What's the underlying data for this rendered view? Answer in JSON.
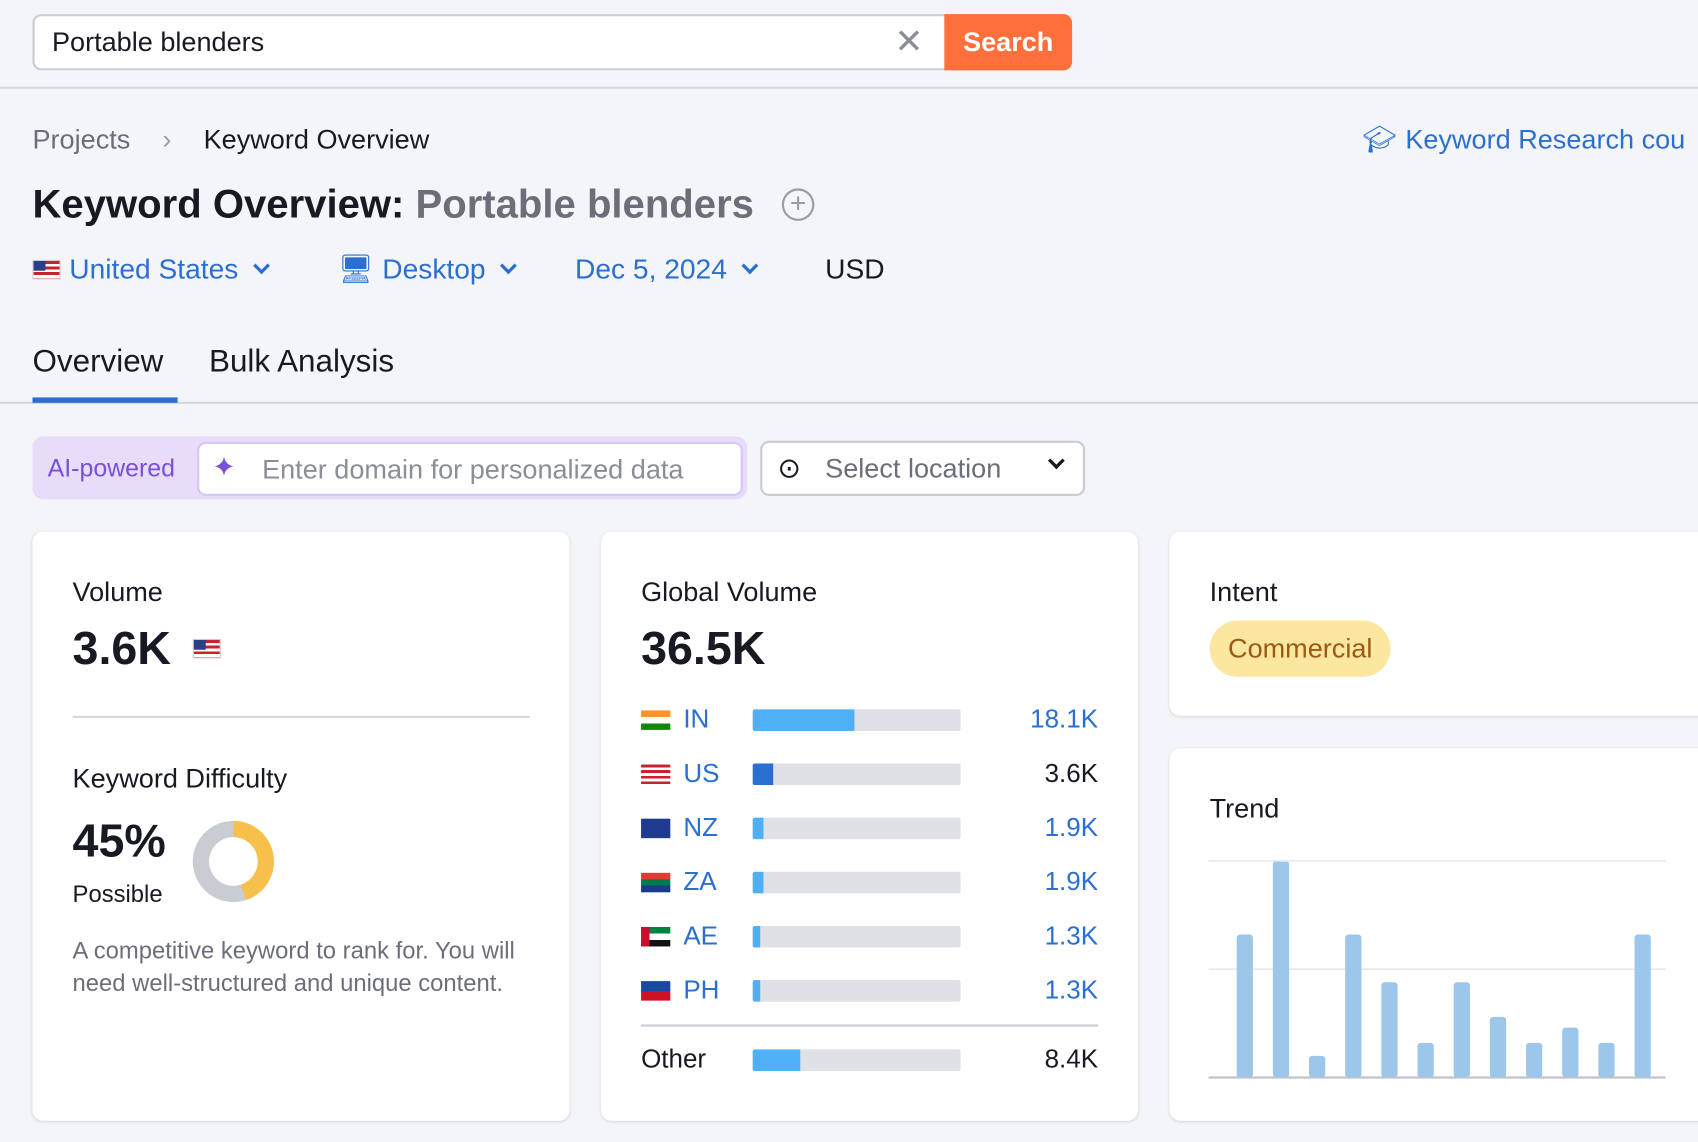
{
  "search": {
    "value": "Portable blenders",
    "button": "Search"
  },
  "breadcrumb": {
    "items": [
      "Projects",
      "Keyword Overview"
    ]
  },
  "course_link": "Keyword Research cou",
  "title": {
    "prefix": "Keyword Overview:",
    "keyword": "Portable blenders"
  },
  "filters": {
    "country": "United States",
    "device": "Desktop",
    "date": "Dec 5, 2024",
    "currency": "USD"
  },
  "tabs": [
    {
      "label": "Overview",
      "active": true
    },
    {
      "label": "Bulk Analysis",
      "active": false
    }
  ],
  "personalize": {
    "badge": "AI-powered",
    "placeholder": "Enter domain for personalized data",
    "location": "Select location"
  },
  "volume": {
    "label": "Volume",
    "value": "3.6K"
  },
  "difficulty": {
    "label": "Keyword Difficulty",
    "value": "45%",
    "level": "Possible",
    "percent": 45,
    "description": "A competitive keyword to rank for. You will need well-structured and unique content.",
    "color": "#f7c04a"
  },
  "global": {
    "label": "Global Volume",
    "value": "36.5K",
    "countries": [
      {
        "code": "IN",
        "value": "18.1K",
        "share": 0.49,
        "link": true
      },
      {
        "code": "US",
        "value": "3.6K",
        "share": 0.1,
        "link": false
      },
      {
        "code": "NZ",
        "value": "1.9K",
        "share": 0.05,
        "link": true
      },
      {
        "code": "ZA",
        "value": "1.9K",
        "share": 0.05,
        "link": true
      },
      {
        "code": "AE",
        "value": "1.3K",
        "share": 0.035,
        "link": true
      },
      {
        "code": "PH",
        "value": "1.3K",
        "share": 0.035,
        "link": true
      }
    ],
    "other": {
      "label": "Other",
      "value": "8.4K",
      "share": 0.23
    }
  },
  "intent": {
    "label": "Intent",
    "value": "Commercial"
  },
  "trend": {
    "label": "Trend"
  },
  "chart_data": {
    "type": "bar",
    "title": "Trend",
    "values": [
      0.66,
      1,
      0.1,
      0.66,
      0.44,
      0.16,
      0.44,
      0.28,
      0.16,
      0.23,
      0.16,
      0.66
    ],
    "ylim": [
      0,
      1
    ],
    "grid": true,
    "color": "#9cc7ea"
  }
}
